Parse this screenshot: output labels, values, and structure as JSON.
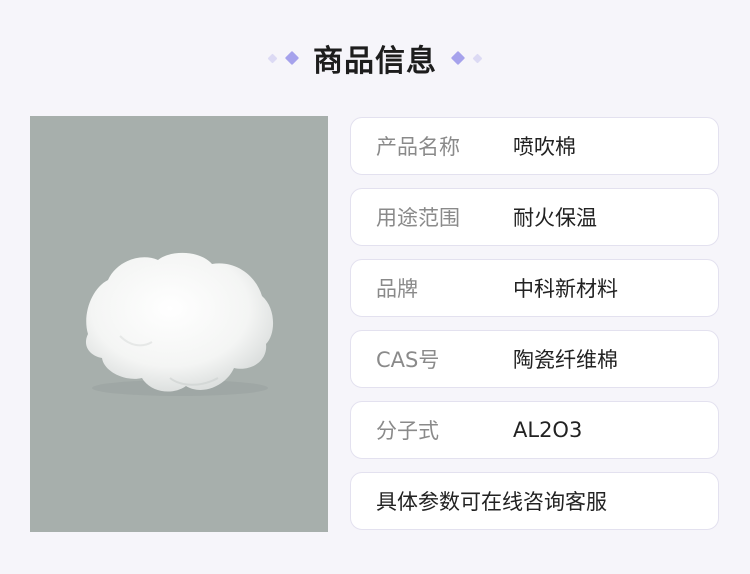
{
  "header": {
    "title": "商品信息"
  },
  "product_image": {
    "subject": "cotton-icon"
  },
  "specs": [
    {
      "label": "产品名称",
      "value": "喷吹棉"
    },
    {
      "label": "用途范围",
      "value": "耐火保温"
    },
    {
      "label": "品牌",
      "value": "中科新材料"
    },
    {
      "label": "CAS号",
      "value": "陶瓷纤维棉"
    },
    {
      "label": "分子式",
      "value": "AL2O3"
    }
  ],
  "note": "具体参数可在线咨询客服",
  "colors": {
    "background": "#f6f5fa",
    "accent": "#a6a2ec",
    "photo_background": "#a7afac"
  }
}
